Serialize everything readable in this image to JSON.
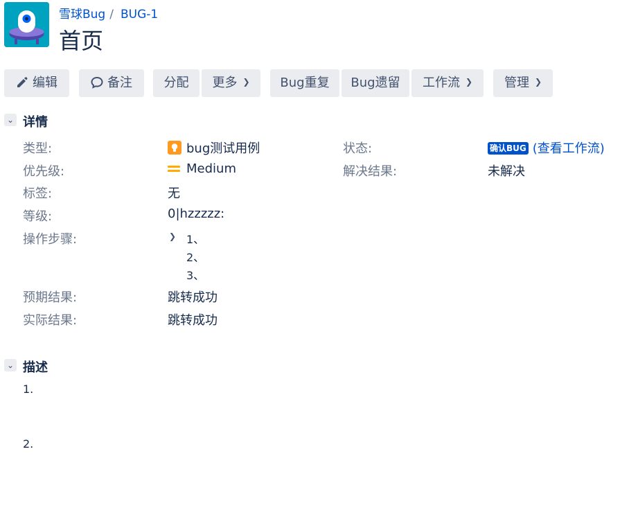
{
  "header": {
    "project": "雪球Bug",
    "separator": "/",
    "issue_key": "BUG-1",
    "title": "首页"
  },
  "toolbar": {
    "edit": "编辑",
    "comment": "备注",
    "assign": "分配",
    "more": "更多",
    "bug_duplicate": "Bug重复",
    "bug_leftover": "Bug遗留",
    "workflow": "工作流",
    "admin": "管理"
  },
  "details": {
    "section_title": "详情",
    "type_label": "类型:",
    "type_value": "bug测试用例",
    "priority_label": "优先级:",
    "priority_value": "Medium",
    "tags_label": "标签:",
    "tags_value": "无",
    "level_label": "等级:",
    "level_value": "0|hzzzzz:",
    "steps_label": "操作步骤:",
    "steps": [
      "1、",
      "2、",
      "3、"
    ],
    "expected_label": "预期结果:",
    "expected_value": "跳转成功",
    "actual_label": "实际结果:",
    "actual_value": "跳转成功",
    "status_label": "状态:",
    "status_value": "确认BUG",
    "view_workflow": "(查看工作流)",
    "resolution_label": "解决结果:",
    "resolution_value": "未解决"
  },
  "description": {
    "section_title": "描述",
    "items": [
      "1.",
      "2."
    ]
  },
  "colors": {
    "accent": "#0052cc",
    "button_bg": "#ebecf0",
    "type_icon": "#ff991f",
    "priority_icon": "#ffab00",
    "avatar_bg": "#00a3bf"
  },
  "icons": {
    "avatar": "ufo-alien-icon",
    "edit": "pencil-icon",
    "comment": "speech-bubble-icon",
    "dropdown": "chevron-down-icon",
    "collapse": "chevron-down-icon",
    "type": "lightbulb-icon",
    "priority": "equals-medium-icon"
  }
}
